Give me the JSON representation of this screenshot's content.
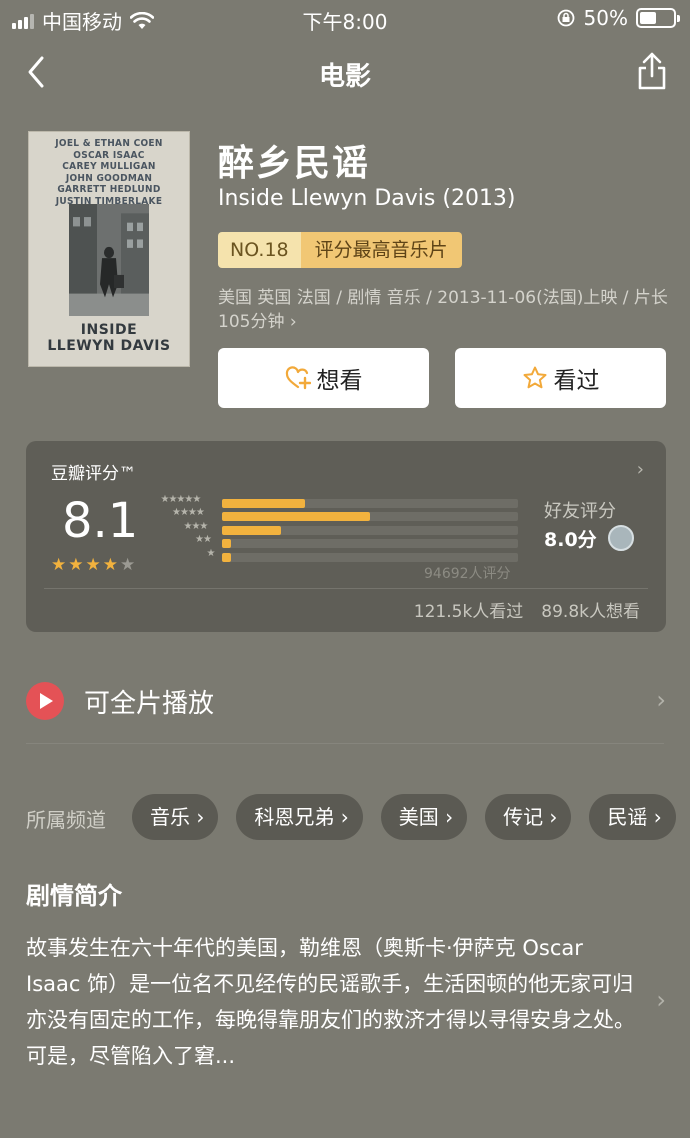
{
  "status_bar": {
    "carrier": "中国移动",
    "time": "下午8:00",
    "battery": "50%",
    "battery_level": 0.5,
    "icons": [
      "signal-icon",
      "wifi-icon",
      "orientation-lock-icon",
      "battery-icon"
    ]
  },
  "nav": {
    "title": "电影",
    "back_icon": "chevron-left-icon",
    "share_icon": "share-icon"
  },
  "poster": {
    "credits": [
      "JOEL & ETHAN COEN",
      "OSCAR ISAAC",
      "CAREY MULLIGAN",
      "JOHN GOODMAN",
      "GARRETT HEDLUND",
      "JUSTIN TIMBERLAKE"
    ],
    "title_line1": "INSIDE",
    "title_line2": "LLEWYN DAVIS"
  },
  "movie": {
    "title_cn": "醉乡民谣",
    "title_en": "Inside Llewyn Davis (2013)",
    "rank_no": "NO.18",
    "rank_text": "评分最高音乐片",
    "meta": "美国 英国 法国 / 剧情 音乐 / 2013-11-06(法国)上映 / 片长105分钟 ›"
  },
  "actions": {
    "want": "想看",
    "seen": "看过"
  },
  "rating": {
    "label": "豆瓣评分™",
    "score": "8.1",
    "stars": 4,
    "distribution": [
      {
        "stars": "★★★★★",
        "fraction": 0.28
      },
      {
        "stars": "★★★★",
        "fraction": 0.5
      },
      {
        "stars": "★★★",
        "fraction": 0.2
      },
      {
        "stars": "★★",
        "fraction": 0.03
      },
      {
        "stars": "★",
        "fraction": 0.03
      }
    ],
    "count": "94692人评分",
    "friend_label": "好友评分",
    "friend_score": "8.0分",
    "seen_count": "121.5k人看过",
    "want_count": "89.8k人想看"
  },
  "play": {
    "label": "可全片播放"
  },
  "channels": {
    "label": "所属频道",
    "items": [
      "音乐 ›",
      "科恩兄弟 ›",
      "美国 ›",
      "传记 ›",
      "民谣 ›"
    ]
  },
  "synopsis": {
    "title": "剧情简介",
    "text": "故事发生在六十年代的美国，勒维恩（奥斯卡·伊萨克 Oscar Isaac 饰）是一位名不见经传的民谣歌手，生活困顿的他无家可归亦没有固定的工作，每晚得靠朋友们的救济才得以寻得安身之处。可是，尽管陷入了窘..."
  },
  "colors": {
    "background": "#7b7a71",
    "card": "#5f5e57",
    "accent_star": "#f2b23e",
    "play_red": "#e45256",
    "rank_left": "#f5e3ad",
    "rank_right": "#f1c774"
  }
}
